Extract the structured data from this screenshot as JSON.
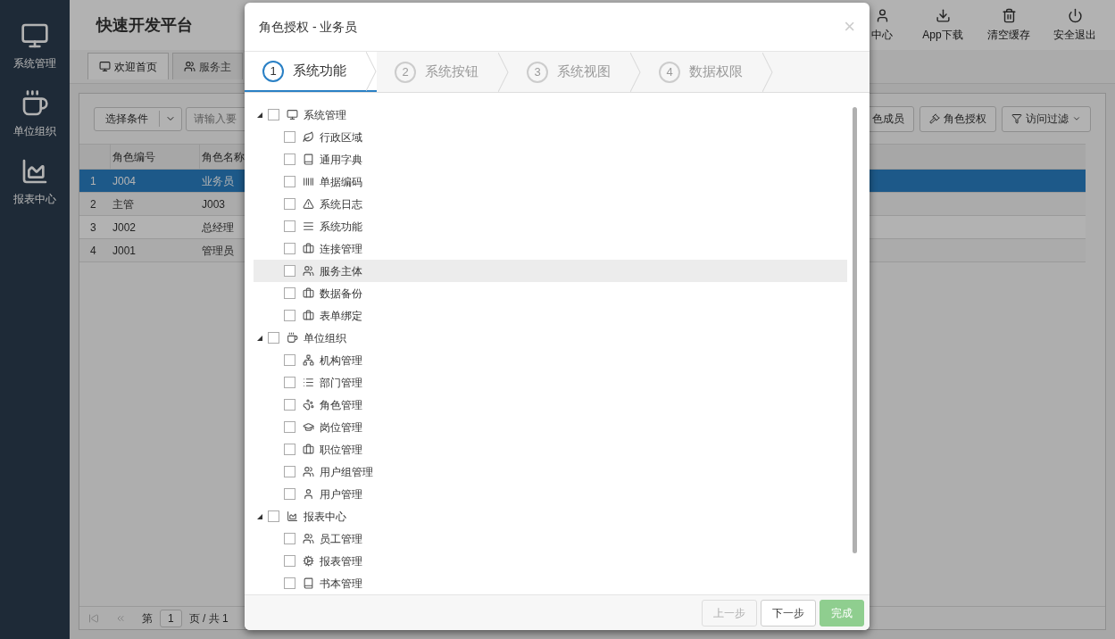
{
  "sidebar": {
    "items": [
      {
        "label": "系统管理"
      },
      {
        "label": "单位组织"
      },
      {
        "label": "报表中心"
      }
    ]
  },
  "header": {
    "title": "快速开发平台",
    "actions": [
      {
        "label": "中心"
      },
      {
        "label": "App下载"
      },
      {
        "label": "清空缓存"
      },
      {
        "label": "安全退出"
      }
    ]
  },
  "tabs": [
    {
      "label": "欢迎首页",
      "selected": true
    },
    {
      "label": "服务主",
      "selected": false
    }
  ],
  "toolbar": {
    "condition": "选择条件",
    "search": {
      "placeholder": "请输入要"
    },
    "buttons": [
      {
        "label": "色成员"
      },
      {
        "label": "角色授权"
      },
      {
        "label": "访问过滤"
      }
    ]
  },
  "table": {
    "columns": [
      "角色编号",
      "角色名称"
    ],
    "rows": [
      {
        "index": "1",
        "cells": [
          "J004",
          "业务员"
        ],
        "selected": true
      },
      {
        "index": "2",
        "cells": [
          "主管",
          "J003"
        ],
        "selected": false
      },
      {
        "index": "3",
        "cells": [
          "J002",
          "总经理"
        ],
        "selected": false
      },
      {
        "index": "4",
        "cells": [
          "J001",
          "管理员"
        ],
        "selected": false
      }
    ]
  },
  "pagination": {
    "prefix": "第",
    "page": "1",
    "suffix": "页 / 共 1"
  },
  "dialog": {
    "title": "角色授权 - 业务员",
    "close": "×",
    "steps": [
      {
        "number": "1",
        "label": "系统功能",
        "selected": true
      },
      {
        "number": "2",
        "label": "系统按钮",
        "selected": false
      },
      {
        "number": "3",
        "label": "系统视图",
        "selected": false
      },
      {
        "number": "4",
        "label": "数据权限",
        "selected": false
      }
    ],
    "tree": [
      {
        "label": "系统管理",
        "checked": false,
        "expanded": true,
        "highlighted": false,
        "children": [
          {
            "label": "行政区域",
            "checked": false,
            "highlighted": false
          },
          {
            "label": "通用字典",
            "checked": false,
            "highlighted": false
          },
          {
            "label": "单据编码",
            "checked": false,
            "highlighted": false
          },
          {
            "label": "系统日志",
            "checked": false,
            "highlighted": false
          },
          {
            "label": "系统功能",
            "checked": false,
            "highlighted": false
          },
          {
            "label": "连接管理",
            "checked": false,
            "highlighted": false
          },
          {
            "label": "服务主体",
            "checked": false,
            "highlighted": true
          },
          {
            "label": "数据备份",
            "checked": false,
            "highlighted": false
          },
          {
            "label": "表单绑定",
            "checked": false,
            "highlighted": false
          }
        ]
      },
      {
        "label": "单位组织",
        "checked": false,
        "expanded": true,
        "highlighted": false,
        "children": [
          {
            "label": "机构管理",
            "checked": false,
            "highlighted": false
          },
          {
            "label": "部门管理",
            "checked": false,
            "highlighted": false
          },
          {
            "label": "角色管理",
            "checked": false,
            "highlighted": false
          },
          {
            "label": "岗位管理",
            "checked": false,
            "highlighted": false
          },
          {
            "label": "职位管理",
            "checked": false,
            "highlighted": false
          },
          {
            "label": "用户组管理",
            "checked": false,
            "highlighted": false
          },
          {
            "label": "用户管理",
            "checked": false,
            "highlighted": false
          }
        ]
      },
      {
        "label": "报表中心",
        "checked": false,
        "expanded": true,
        "highlighted": false,
        "children": [
          {
            "label": "员工管理",
            "checked": false,
            "highlighted": false
          },
          {
            "label": "报表管理",
            "checked": false,
            "highlighted": false
          },
          {
            "label": "书本管理",
            "checked": false,
            "highlighted": false
          }
        ]
      }
    ],
    "buttons": [
      {
        "label": "上一步",
        "kind": "default",
        "disabled": true
      },
      {
        "label": "下一步",
        "kind": "default",
        "disabled": false
      },
      {
        "label": "完成",
        "kind": "success",
        "disabled": true
      }
    ]
  }
}
